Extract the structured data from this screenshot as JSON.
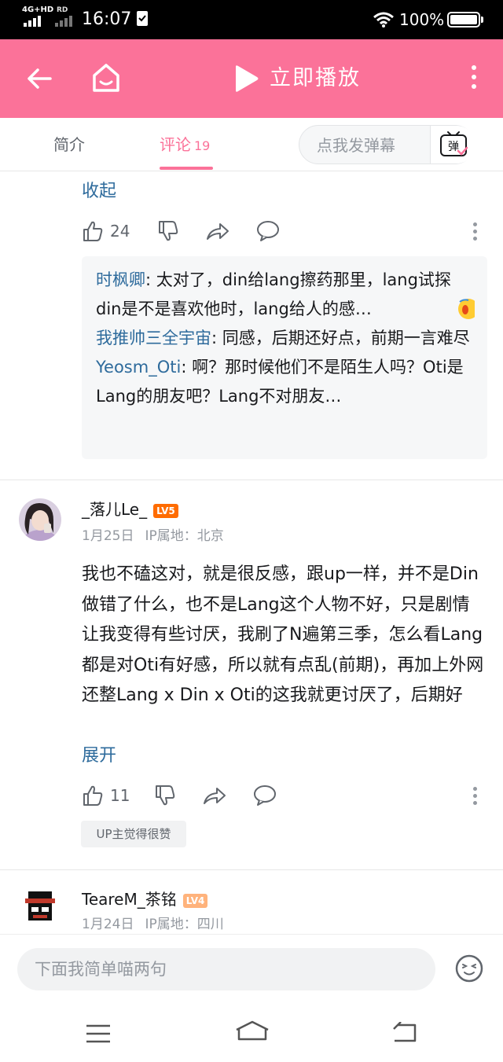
{
  "status_bar": {
    "network": "4G+HD",
    "network2": "RD",
    "time": "16:07",
    "battery": "100%"
  },
  "app_bar": {
    "play_label": "立即播放"
  },
  "tabs": {
    "intro": "简介",
    "comments": "评论",
    "comment_count": "19",
    "danmaku_placeholder": "点我发弹幕",
    "danmaku_button": "弹"
  },
  "first_comment": {
    "collapse_label": "收起",
    "like_count": "24",
    "replies": [
      {
        "name": "时枫卿",
        "text": ": 太对了，din给lang擦药那里，lang试探din是不是喜欢他时，lang给人的感…"
      },
      {
        "name": "我推帅三全宇宙",
        "text": ": 同感，后期还好点，前期一言难尽"
      },
      {
        "name": "Yeosm_Oti",
        "text": ": 啊？那时候他们不是陌生人吗？Oti是Lang的朋友吧？Lang不对朋友…"
      }
    ]
  },
  "second_comment": {
    "username": "_落儿Le_",
    "level": "LV5",
    "date": "1月25日",
    "ip": "IP属地：北京",
    "body": "我也不磕这对，就是很反感，跟up一样，并不是Din做错了什么，也不是Lang这个人物不好，只是剧情让我变得有些讨厌，我刷了N遍第三季，怎么看Lang都是对Oti有好感，所以就有点乱(前期)，再加上外网还整Lang x Din x Oti的这我就更讨厌了，后期好",
    "expand_label": "展开",
    "like_count": "11",
    "badge": "UP主觉得很赞"
  },
  "third_comment": {
    "username": "TeareM_茶铭",
    "level": "LV4",
    "date": "1月24日",
    "ip": "IP属地：四川"
  },
  "bottom": {
    "input_placeholder": "下面我简单喵两句"
  },
  "colors": {
    "brand_pink": "#fb7299",
    "link_blue": "#2e6b9c",
    "level5": "#ff6c00",
    "level4": "#ffb37c"
  }
}
